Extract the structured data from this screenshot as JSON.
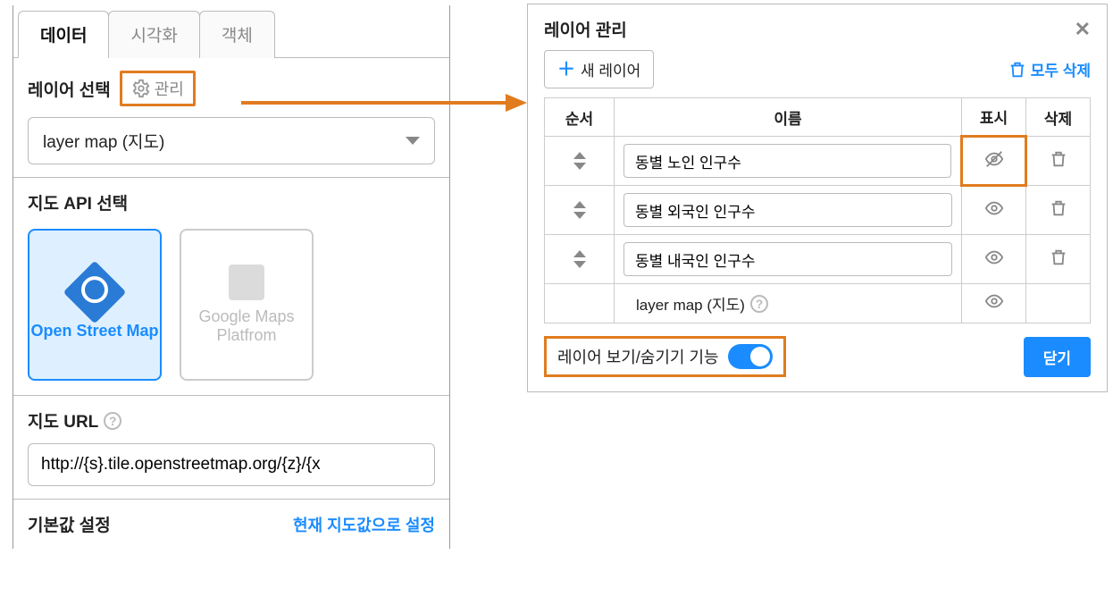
{
  "tabs": {
    "data": "데이터",
    "viz": "시각화",
    "object": "객체"
  },
  "layer_select": {
    "label": "레이어 선택",
    "manage": "관리",
    "value": "layer map (지도)"
  },
  "api_select": {
    "label": "지도 API 선택",
    "osm": "Open Street Map",
    "gmap": "Google Maps Platfrom"
  },
  "map_url": {
    "label": "지도 URL",
    "value": "http://{s}.tile.openstreetmap.org/{z}/{x"
  },
  "defaults": {
    "label": "기본값 설정",
    "action": "현재 지도값으로 설정"
  },
  "dialog": {
    "title": "레이어 관리",
    "new_layer": "새 레이어",
    "delete_all": "모두 삭제",
    "columns": {
      "order": "순서",
      "name": "이름",
      "show": "표시",
      "delete": "삭제"
    },
    "rows": [
      {
        "name": "동별 노인 인구수",
        "visible": false,
        "editable": true,
        "deletable": true
      },
      {
        "name": "동별 외국인 인구수",
        "visible": true,
        "editable": true,
        "deletable": true
      },
      {
        "name": "동별 내국인 인구수",
        "visible": true,
        "editable": true,
        "deletable": true
      },
      {
        "name": "layer map (지도)",
        "visible": true,
        "editable": false,
        "deletable": false
      }
    ],
    "toggle_label": "레이어 보기/숨기기 기능",
    "close": "닫기"
  }
}
